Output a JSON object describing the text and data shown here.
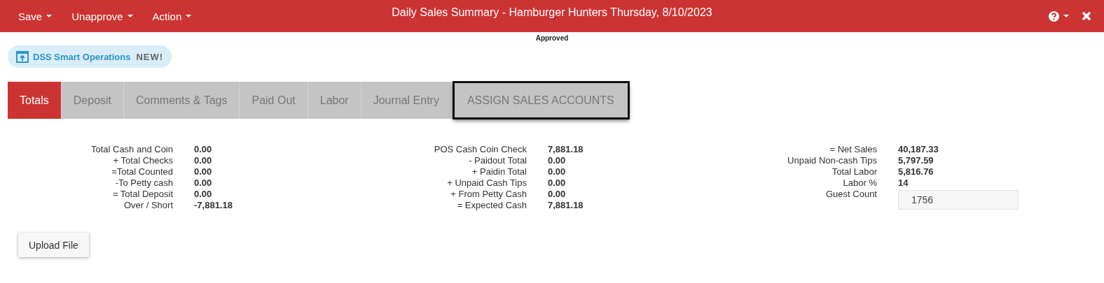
{
  "toolbar": {
    "menus": [
      {
        "label": "Save"
      },
      {
        "label": "Unapprove"
      },
      {
        "label": "Action"
      }
    ],
    "title": "Daily Sales Summary - Hamburger Hunters Thursday, 8/10/2023"
  },
  "status": "Approved",
  "promo": {
    "label": "DSS Smart Operations",
    "badge": "NEW!"
  },
  "tabs": [
    {
      "label": "Totals",
      "selected": true,
      "outlined": false
    },
    {
      "label": "Deposit",
      "selected": false,
      "outlined": false
    },
    {
      "label": "Comments & Tags",
      "selected": false,
      "outlined": false
    },
    {
      "label": "Paid Out",
      "selected": false,
      "outlined": false
    },
    {
      "label": "Labor",
      "selected": false,
      "outlined": false
    },
    {
      "label": "Journal Entry",
      "selected": false,
      "outlined": false
    },
    {
      "label": "ASSIGN SALES ACCOUNTS",
      "selected": false,
      "outlined": true
    }
  ],
  "sections": [
    {
      "rows": [
        {
          "label": "Total Cash and Coin",
          "value": "0.00"
        },
        {
          "label": "+ Total Checks",
          "value": "0.00"
        },
        {
          "label": "=Total Counted",
          "value": "0.00"
        },
        {
          "label": "-To Petty cash",
          "value": "0.00"
        },
        {
          "label": "= Total Deposit",
          "value": "0.00"
        },
        {
          "label": "Over / Short",
          "value": "-7,881.18"
        }
      ]
    },
    {
      "rows": [
        {
          "label": "POS Cash Coin Check",
          "value": "7,881.18"
        },
        {
          "label": "- Paidout Total",
          "value": "0.00"
        },
        {
          "label": "+ Paidin Total",
          "value": "0.00"
        },
        {
          "label": "+ Unpaid Cash Tips",
          "value": "0.00"
        },
        {
          "label": "+ From Petty Cash",
          "value": "0.00"
        },
        {
          "label": "= Expected Cash",
          "value": "7,881.18"
        }
      ]
    },
    {
      "rows": [
        {
          "label": "= Net Sales",
          "value": "40,187.33"
        },
        {
          "label": "Unpaid Non-cash Tips",
          "value": "5,797.59"
        },
        {
          "label": "Total Labor",
          "value": "5,816.76"
        },
        {
          "label": "Labor %",
          "value": "14"
        },
        {
          "label": "Guest Count",
          "kind": "field",
          "value": "1756"
        }
      ]
    }
  ],
  "upload_button": "Upload File"
}
